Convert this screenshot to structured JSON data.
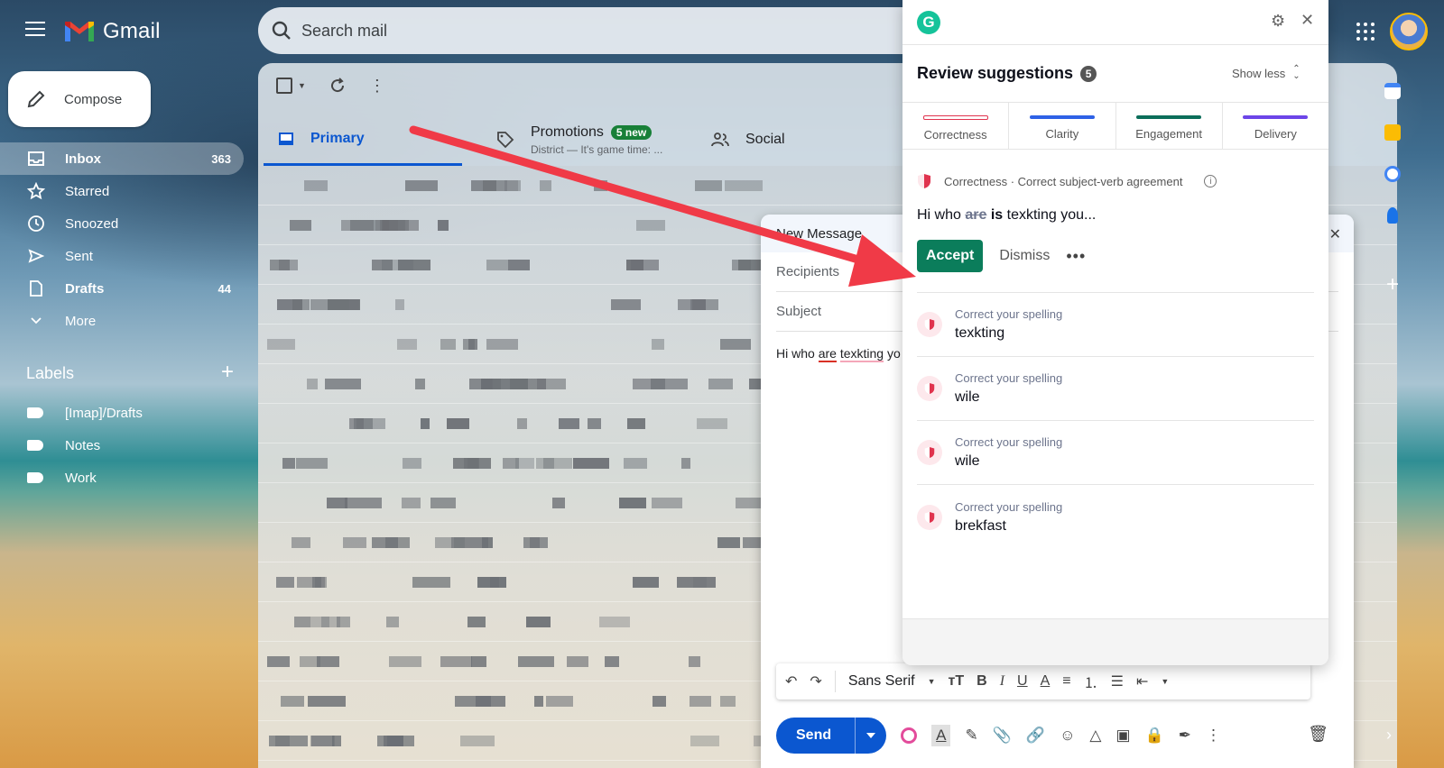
{
  "app": {
    "name": "Gmail",
    "search_placeholder": "Search mail"
  },
  "sidebar": {
    "compose_label": "Compose",
    "items": [
      {
        "label": "Inbox",
        "count": "363",
        "icon": "inbox-icon"
      },
      {
        "label": "Starred",
        "count": "",
        "icon": "star-icon"
      },
      {
        "label": "Snoozed",
        "count": "",
        "icon": "clock-icon"
      },
      {
        "label": "Sent",
        "count": "",
        "icon": "send-icon"
      },
      {
        "label": "Drafts",
        "count": "44",
        "icon": "file-icon"
      },
      {
        "label": "More",
        "count": "",
        "icon": "chevron-down-icon"
      }
    ],
    "labels_title": "Labels",
    "labels": [
      "[Imap]/Drafts",
      "Notes",
      "Work"
    ]
  },
  "mail": {
    "tabs": {
      "primary": "Primary",
      "promotions": "Promotions",
      "promotions_badge": "5 new",
      "promotions_sub": "District — It's game time: ...",
      "social": "Social"
    }
  },
  "compose_window": {
    "title": "New Message",
    "recipients_placeholder": "Recipients",
    "subject_placeholder": "Subject",
    "body_before": "Hi who ",
    "body_err1": "are",
    "body_space": " ",
    "body_err2": "texkting",
    "body_after": " yo",
    "font_name": "Sans Serif",
    "send_label": "Send"
  },
  "grammarly": {
    "title": "Review suggestions",
    "count": "5",
    "show_less": "Show less",
    "categories": [
      {
        "label": "Correctness",
        "color": "#e0334e"
      },
      {
        "label": "Clarity",
        "color": "#2e61e6"
      },
      {
        "label": "Engagement",
        "color": "#0b6e5a"
      },
      {
        "label": "Delivery",
        "color": "#6c45e8"
      }
    ],
    "active_card": {
      "category": "Correctness · Correct subject-verb agreement",
      "sentence_before": "Hi who ",
      "sentence_strike": "are",
      "sentence_fix": "is",
      "sentence_after": " texkting you...",
      "accept_label": "Accept",
      "dismiss_label": "Dismiss"
    },
    "suggestions": [
      {
        "category": "Correct your spelling",
        "word": "texkting"
      },
      {
        "category": "Correct your spelling",
        "word": "wile"
      },
      {
        "category": "Correct your spelling",
        "word": "wile"
      },
      {
        "category": "Correct your spelling",
        "word": "brekfast"
      }
    ]
  },
  "colors": {
    "gmail_blue": "#0b57d0",
    "grammarly_green": "#0b7d5b",
    "arrow_red": "#f03a47"
  }
}
